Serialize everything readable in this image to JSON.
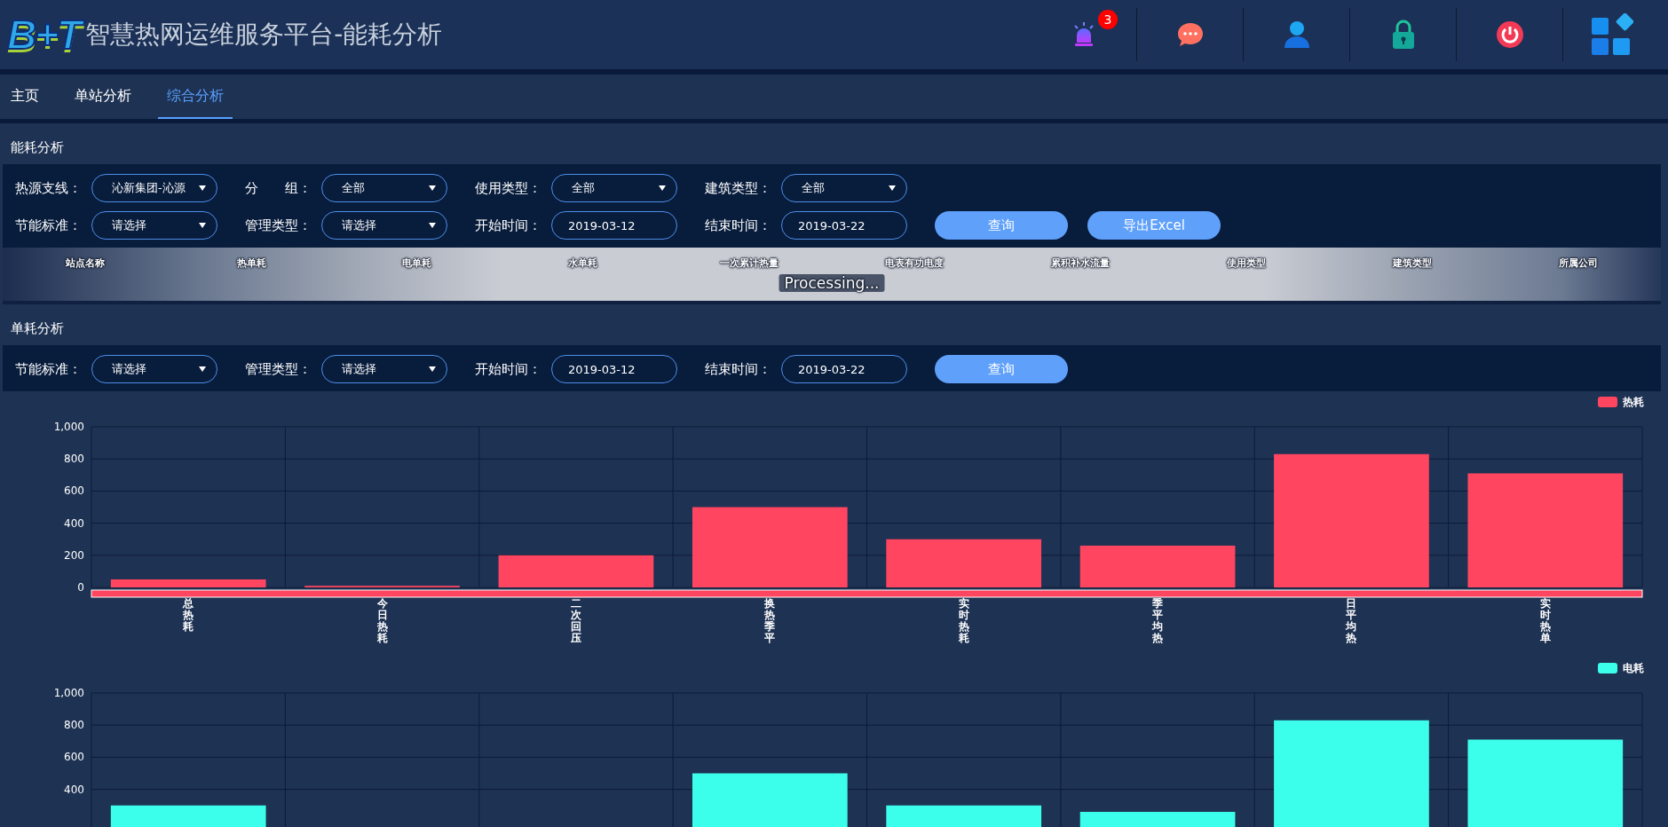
{
  "header": {
    "logo_text": "B+T",
    "title": "智慧热网运维服务平台-能耗分析",
    "alarm_count": "3"
  },
  "tabs": [
    {
      "label": "主页",
      "selected": false
    },
    {
      "label": "单站分析",
      "selected": false
    },
    {
      "label": "综合分析",
      "selected": true
    }
  ],
  "energy_section": {
    "title": "能耗分析",
    "filter_rows": [
      [
        {
          "kind": "select",
          "label": "热源支线：",
          "value": "沁新集团-沁源"
        },
        {
          "kind": "select",
          "label": "分　　组：",
          "value": "全部"
        },
        {
          "kind": "select",
          "label": "使用类型：",
          "value": "全部"
        },
        {
          "kind": "select",
          "label": "建筑类型：",
          "value": "全部"
        }
      ],
      [
        {
          "kind": "select",
          "label": "节能标准：",
          "value": "请选择"
        },
        {
          "kind": "select",
          "label": "管理类型：",
          "value": "请选择"
        },
        {
          "kind": "date",
          "label": "开始时间：",
          "value": "2019-03-12"
        },
        {
          "kind": "date",
          "label": "结束时间：",
          "value": "2019-03-22"
        },
        {
          "kind": "button",
          "label": "查询"
        },
        {
          "kind": "button",
          "label": "导出Excel"
        }
      ]
    ],
    "table": {
      "columns": [
        "站点名称",
        "热单耗",
        "电单耗",
        "水单耗",
        "一次累计热量",
        "电表有功电度",
        "累积补水流量",
        "使用类型",
        "建筑类型",
        "所属公司"
      ],
      "processing": "Processing..."
    }
  },
  "unit_section": {
    "title": "单耗分析",
    "filter_rows": [
      [
        {
          "kind": "select",
          "label": "节能标准：",
          "value": "请选择"
        },
        {
          "kind": "select",
          "label": "管理类型：",
          "value": "请选择"
        },
        {
          "kind": "date",
          "label": "开始时间：",
          "value": "2019-03-12"
        },
        {
          "kind": "date",
          "label": "结束时间：",
          "value": "2019-03-22"
        },
        {
          "kind": "button",
          "label": "查询"
        }
      ]
    ]
  },
  "charts": [
    {
      "chart_data": {
        "type": "bar",
        "grid": true,
        "categories": [
          "总热耗",
          "今日热耗",
          "二次回压",
          "换热季平",
          "实时热耗",
          "季平均热",
          "日平均热",
          "实时热单"
        ],
        "series": [
          {
            "name": "热耗",
            "color": "#ff4560",
            "values": [
              50,
              10,
              200,
              500,
              300,
              260,
              830,
              710
            ]
          }
        ],
        "ylim": [
          0,
          1000
        ],
        "yticks": [
          0,
          200,
          400,
          600,
          800,
          {
            "value": 1000,
            "label": "1,000"
          }
        ]
      }
    },
    {
      "chart_data": {
        "type": "bar",
        "grid": true,
        "series": [
          {
            "name": "电耗",
            "color": "#3bffea",
            "values": [
              300,
              null,
              null,
              500,
              300,
              260,
              830,
              710
            ]
          }
        ],
        "ylim": [
          0,
          1000
        ],
        "yticks": [
          400,
          600,
          800,
          {
            "value": 1000,
            "label": "1,000"
          }
        ]
      }
    }
  ]
}
